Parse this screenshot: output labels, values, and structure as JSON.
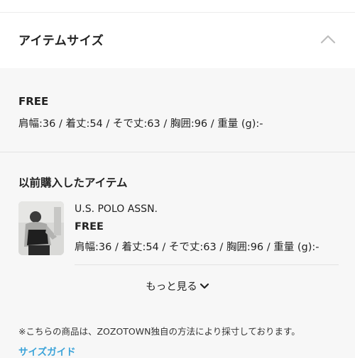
{
  "section": {
    "title": "アイテムサイズ",
    "toggle_icon": "chevron-up-icon"
  },
  "current_size": {
    "label": "FREE",
    "detail": "肩幅:36 / 着丈:54 / そで丈:63 / 胸囲:96 / 重量 (g):-"
  },
  "previous_purchases": {
    "title": "以前購入したアイテム",
    "items": [
      {
        "brand": "U.S. POLO ASSN.",
        "size": "FREE",
        "detail": "肩幅:36 / 着丈:54 / そで丈:63 / 胸囲:96 / 重量 (g):-"
      }
    ],
    "more_label": "もっと見る",
    "more_icon": "chevron-down-icon"
  },
  "footer": {
    "note": "※こちらの商品は、ZOZOTOWN独自の方法により採寸しております。",
    "size_guide_link": "サイズガイド"
  },
  "colors": {
    "link": "#3aa3d9",
    "background": "#f7f7f7",
    "card": "#ffffff"
  }
}
